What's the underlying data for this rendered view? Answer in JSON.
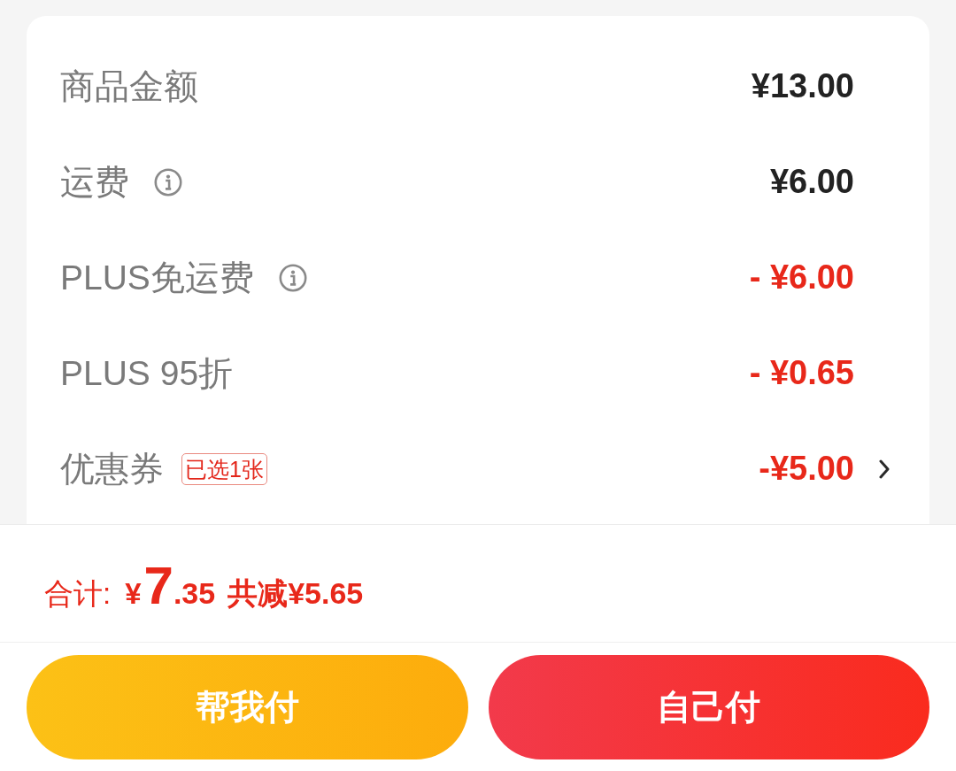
{
  "rows": [
    {
      "label": "商品金额",
      "info": false,
      "value": "¥13.00",
      "kind": "charge",
      "chevron": false
    },
    {
      "label": "运费",
      "info": true,
      "value": "¥6.00",
      "kind": "charge",
      "chevron": false
    },
    {
      "label": "PLUS免运费",
      "info": true,
      "value": "- ¥6.00",
      "kind": "discount",
      "chevron": false
    },
    {
      "label": "PLUS 95折",
      "info": false,
      "value": "- ¥0.65",
      "kind": "discount",
      "chevron": false
    },
    {
      "label": "优惠券",
      "info": false,
      "tag": "已选1张",
      "value": "-¥5.00",
      "kind": "discount",
      "chevron": true
    }
  ],
  "total": {
    "label": "合计:",
    "currency": "¥",
    "integer": "7",
    "decimal": ".35",
    "saving": "共减¥5.65"
  },
  "buttons": [
    {
      "label": "帮我付",
      "kind": "secondary"
    },
    {
      "label": "自己付",
      "kind": "primary"
    }
  ]
}
